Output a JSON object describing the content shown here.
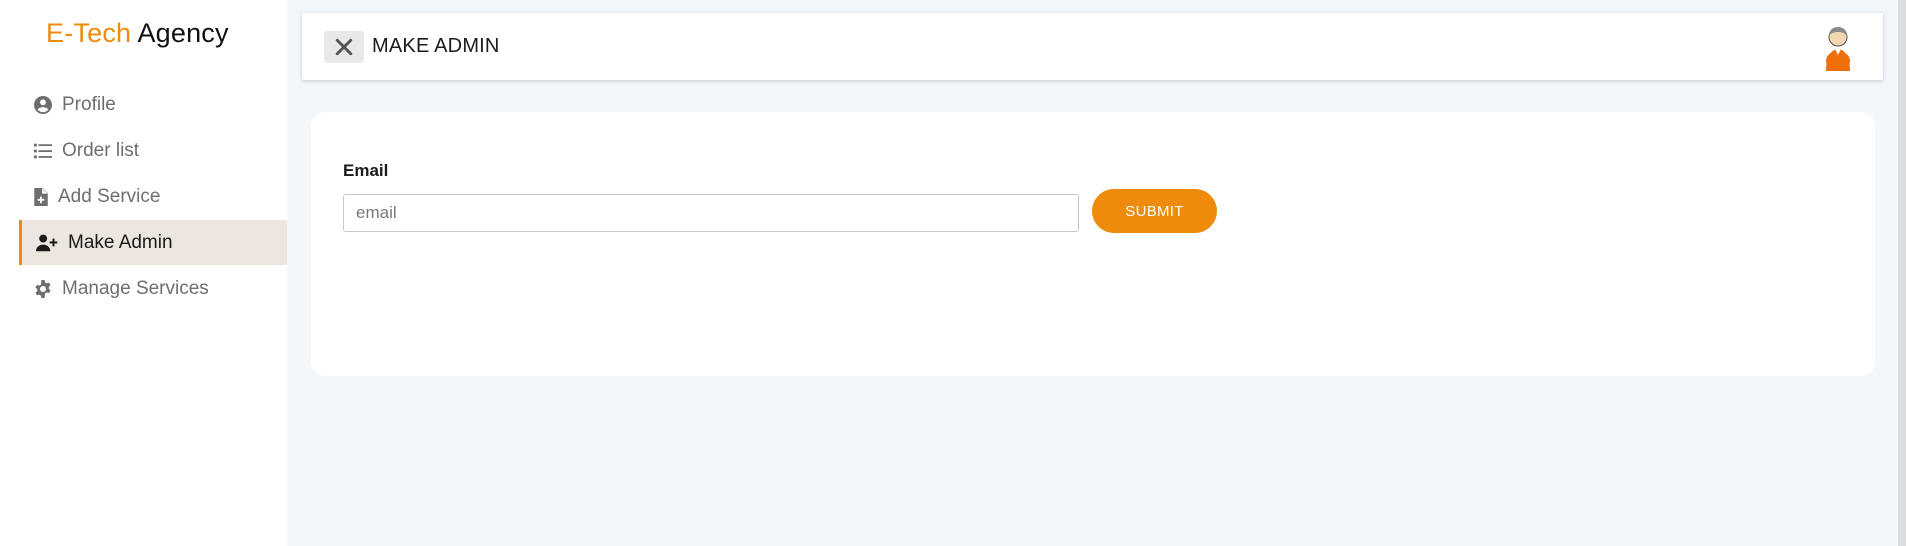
{
  "brand": {
    "accent": "E-Tech",
    "rest": " Agency"
  },
  "sidebar": {
    "items": [
      {
        "label": "Profile",
        "icon": "user-circle-icon"
      },
      {
        "label": "Order list",
        "icon": "list-icon"
      },
      {
        "label": "Add Service",
        "icon": "file-plus-icon"
      },
      {
        "label": "Make Admin",
        "icon": "user-plus-icon",
        "active": true
      },
      {
        "label": "Manage Services",
        "icon": "gear-icon"
      }
    ]
  },
  "header": {
    "title": "MAKE ADMIN",
    "close_icon": "close-icon",
    "avatar_icon": "user-avatar-icon"
  },
  "form": {
    "email_label": "Email",
    "email_placeholder": "email",
    "email_value": "",
    "submit_label": "SUBMIT"
  },
  "colors": {
    "accent": "#ee8a0c",
    "active_bg": "#ede6de",
    "page_bg": "#f3f6fb"
  }
}
